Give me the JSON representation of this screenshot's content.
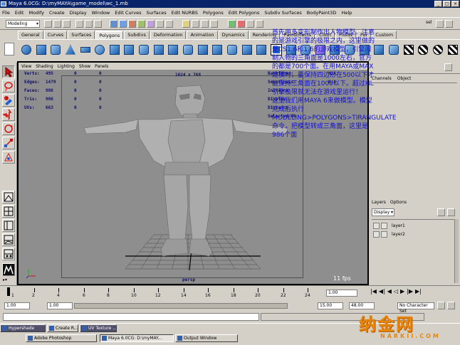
{
  "window": {
    "title": "Maya 6.0CG: D:\\myMAYA\\game_model\\wc_1.mb",
    "controls": [
      "_",
      "□",
      "×"
    ]
  },
  "menubar": [
    "File",
    "Edit",
    "Modify",
    "Create",
    "Display",
    "Window",
    "Edit Curves",
    "Surfaces",
    "Edit NURBS",
    "Polygons",
    "Edit Polygons",
    "Subdiv Surfaces",
    "BodyPaint3D",
    "Help"
  ],
  "statusline": {
    "mode": "Modeling",
    "sel_label": "sel"
  },
  "shelf": {
    "tabs": [
      "General",
      "Curves",
      "Surfaces",
      "Polygons",
      "Subdivs",
      "Deformation",
      "Animation",
      "Dynamics",
      "Rendering",
      "PaintEffects",
      "Cloth",
      "Fluids",
      "Fur",
      "Custom"
    ],
    "active_tab": "Polygons"
  },
  "panel": {
    "menu": [
      "View",
      "Shading",
      "Lighting",
      "Show",
      "Panels"
    ],
    "resolution": "1024 x 768",
    "camera": "persp",
    "fps": "11 fps"
  },
  "hud_left": [
    {
      "label": "Verts:",
      "v1": "495",
      "v2": "0",
      "v3": "0"
    },
    {
      "label": "Edges:",
      "v1": "1479",
      "v2": "0",
      "v3": "0"
    },
    {
      "label": "Faces:",
      "v1": "986",
      "v2": "0",
      "v3": "0"
    },
    {
      "label": "Tris:",
      "v1": "986",
      "v2": "0",
      "v3": "0"
    },
    {
      "label": "UVs:",
      "v1": "663",
      "v2": "0",
      "v3": "0"
    }
  ],
  "hud_right": [
    {
      "label": "Backfaces:",
      "value": "N/A"
    },
    {
      "label": "Smoothness:",
      "value": "N/A"
    },
    {
      "label": "Instance",
      "value": ""
    },
    {
      "label": "Display",
      "value": ""
    },
    {
      "label": "Distance",
      "value": ""
    },
    {
      "label": "Selected Ob",
      "value": ""
    }
  ],
  "annotation": [
    "首先用多变形制作出人物模型。注意的是游戏引擎的极限之内，这里做的是CS1.6和1.6的游戏模型，引擎限制人物的三角面是1000左右，官方的都是700个面。在用MAYA或MAX建模时，要保持四边形在500以下才能保持三角面在1000以下。超过HL引擎极限就无法在游戏里运行！",
    "这里我们用MAYA 6来做模型。模型完成后执行",
    "MODELING>POLYGONS>TIRANGULATE命令，把模型转成三角面，这里是986个面"
  ],
  "channel_box": {
    "tabs": [
      "Channels",
      "Object"
    ]
  },
  "layers": {
    "tabs": [
      "Layers",
      "Options"
    ],
    "display": "Display",
    "items": [
      "layer1",
      "layer2"
    ]
  },
  "timeline": {
    "ticks": [
      "1",
      "2",
      "4",
      "6",
      "8",
      "10",
      "12",
      "14",
      "16",
      "18",
      "20",
      "22",
      "24"
    ],
    "current_frame": "1.00"
  },
  "range": {
    "start": "1.00",
    "start2": "1.00",
    "end": "15.00",
    "end2": "48.00",
    "character_set": "No Character Set"
  },
  "taskbar": {
    "row1": [
      "Hypershade",
      "Create R...",
      "UV Texture ..."
    ],
    "row2": [
      "Adobe Photoshop",
      "Maya 6.0CG: D:\\myMAY...",
      "Output Window"
    ]
  },
  "watermark": {
    "text": "纳金网",
    "sub": "NARKII.COM"
  },
  "colors": {
    "title_bg": "#0a246a",
    "annotation": "#1010d0",
    "watermark": "#e8860a",
    "viewport": "#8e8e8e",
    "grid": "#000000"
  }
}
